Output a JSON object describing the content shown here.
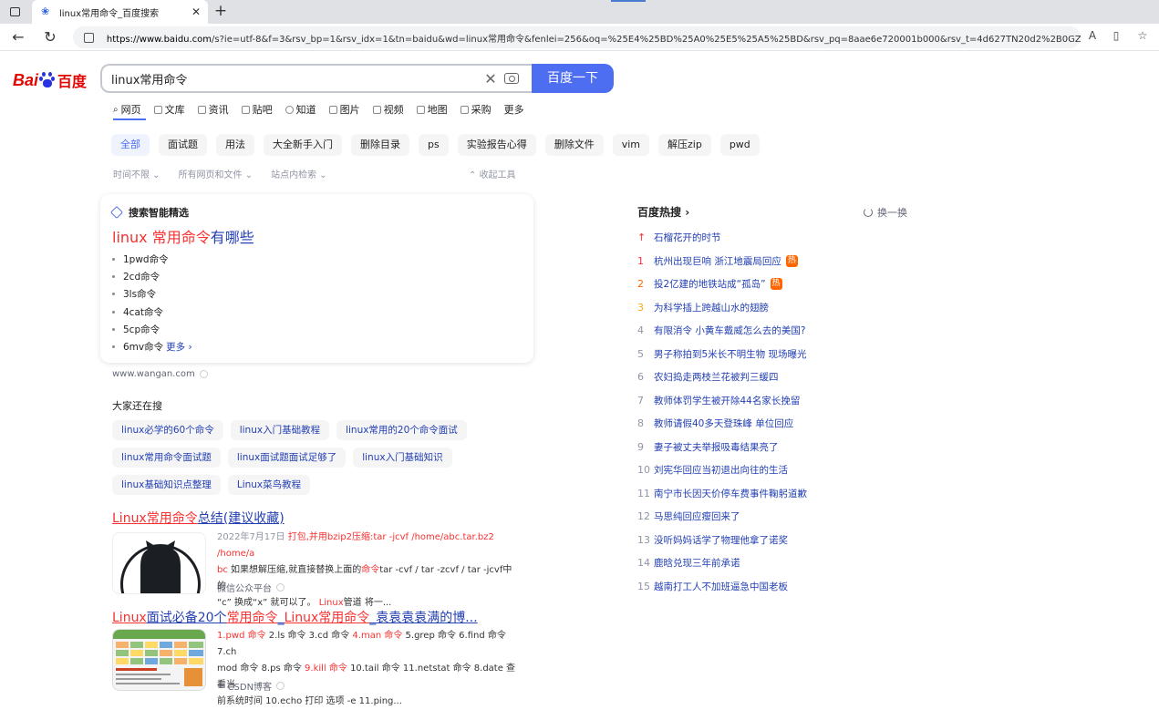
{
  "browser": {
    "tab_title": "linux常用命令_百度搜索",
    "url_host": "https://www.baidu.com",
    "url_rest": "/s?ie=utf-8&f=3&rsv_bp=1&rsv_idx=1&tn=baidu&wd=linux常用命令&fenlei=256&oq=%25E4%25BD%25A0%25E5%25A5%25BD&rsv_pq=8aae6e720001b000&rsv_t=4d627TN20d2%2B0GZ..."
  },
  "logo": {
    "bai": "Bai",
    "du": "百度"
  },
  "search": {
    "query": "linux常用命令",
    "button": "百度一下"
  },
  "tabs": [
    "网页",
    "文库",
    "资讯",
    "贴吧",
    "知道",
    "图片",
    "视频",
    "地图",
    "采购",
    "更多"
  ],
  "chips": [
    "全部",
    "面试题",
    "用法",
    "大全新手入门",
    "删除目录",
    "ps",
    "实验报告心得",
    "删除文件",
    "vim",
    "解压zip",
    "pwd"
  ],
  "filters": {
    "time": "时间不限",
    "files": "所有网页和文件",
    "site": "站点内检索",
    "collapse": "收起工具"
  },
  "smart_card": {
    "label": "搜索智能精选",
    "title_em": "linux 常用命令",
    "title_rest": "有哪些",
    "items": [
      "1pwd命令",
      "2cd命令",
      "3ls命令",
      "4cat命令",
      "5cp命令",
      "6mv命令"
    ],
    "more": "更多",
    "source": "www.wangan.com"
  },
  "also_searching": {
    "title": "大家还在搜",
    "rows": [
      [
        "linux必学的60个命令",
        "linux入门基础教程",
        "linux常用的20个命令面试"
      ],
      [
        "linux常用命令面试题",
        "linux面试题面试足够了",
        "linux入门基础知识"
      ],
      [
        "linux基础知识点整理",
        "Linux菜鸟教程"
      ]
    ]
  },
  "results": [
    {
      "title_em": "Linux常用命令",
      "title_rest": "总结(建议收藏)",
      "date": "2022年7月17日",
      "line1_em": "打包,并用bzip2压缩:tar -jcvf /home/abc.tar.bz2 /home/a",
      "line2_em": "bc",
      "line2_a": " 如果想解压缩,就直接替换上面的",
      "line2_em2": "命令",
      "line2_b": "tar -cvf / tar -zcvf / tar -jcvf中的",
      "line3_a": "“c” 换成“x” 就可以了。",
      "line3_em": "Linux",
      "line3_b": "管道 将一...",
      "source": "微信公众平台"
    },
    {
      "title_em": "Linux",
      "title_mid": "面试必备20个",
      "title_em2": "常用命令",
      "title_mid2": "_",
      "title_em3": "Linux常用命令",
      "title_rest": "_袁袁袁袁满的博...",
      "line1_em": "1.pwd 命令",
      "line1_a": " 2.ls 命令 3.cd 命令 ",
      "line1_em2": "4.man 命令",
      "line1_b": " 5.grep 命令 6.find 命令 7.ch",
      "line2_a": "mod 命令 8.ps 命令 ",
      "line2_em": "9.kill 命令",
      "line2_b": " 10.tail 命令 11.netstat 命令 8.date 查看当",
      "line3": "前系统时间 10.echo 打印 选项 -e 11.ping...",
      "source": "CSDN博客"
    }
  ],
  "hot": {
    "title": "百度热搜",
    "refresh": "换一换",
    "items": [
      {
        "num": "↑",
        "text": "石榴花开的时节",
        "badge": ""
      },
      {
        "num": "1",
        "text": "杭州出现巨响 浙江地震局回应",
        "badge": "热"
      },
      {
        "num": "2",
        "text": "投2亿建的地铁站成“孤岛”",
        "badge": "热"
      },
      {
        "num": "3",
        "text": "为科学插上跨越山水的翅膀",
        "badge": ""
      },
      {
        "num": "4",
        "text": "有限消令 小黄车戴威怎么去的美国?",
        "badge": ""
      },
      {
        "num": "5",
        "text": "男子称拍到5米长不明生物 现场曝光",
        "badge": ""
      },
      {
        "num": "6",
        "text": "农妇捣走两枝兰花被判三缓四",
        "badge": ""
      },
      {
        "num": "7",
        "text": "教师体罚学生被开除44名家长挽留",
        "badge": ""
      },
      {
        "num": "8",
        "text": "教师请假40多天登珠峰 单位回应",
        "badge": ""
      },
      {
        "num": "9",
        "text": "妻子被丈夫举报吸毒结果亮了",
        "badge": ""
      },
      {
        "num": "10",
        "text": "刘宪华回应当初退出向往的生活",
        "badge": ""
      },
      {
        "num": "11",
        "text": "南宁市长因天价停车费事件鞠躬道歉",
        "badge": ""
      },
      {
        "num": "12",
        "text": "马思纯回应瘦回来了",
        "badge": ""
      },
      {
        "num": "13",
        "text": "没听妈妈话学了物理他拿了诺奖",
        "badge": ""
      },
      {
        "num": "14",
        "text": "鹿晗兑现三年前承诺",
        "badge": ""
      },
      {
        "num": "15",
        "text": "越南打工人不加班逼急中国老板",
        "badge": ""
      }
    ]
  }
}
